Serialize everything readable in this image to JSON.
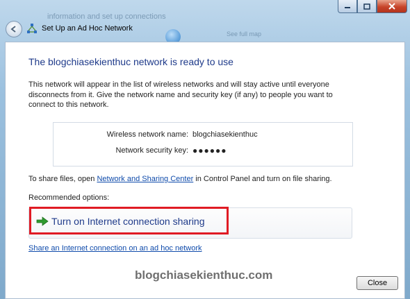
{
  "window": {
    "title": "Set Up an Ad Hoc Network",
    "caption_buttons": [
      "minimize",
      "maximize",
      "close"
    ]
  },
  "background": {
    "text_1": "information and set up connections",
    "text_2": "See full map"
  },
  "main": {
    "heading": "The blogchiasekienthuc network is ready to use",
    "description": "This network will appear in the list of wireless networks and will stay active until everyone disconnects from it. Give the network name and security key (if any) to people you want to connect to this network.",
    "network_name_label": "Wireless network name:",
    "network_name_value": "blogchiasekienthuc",
    "security_key_label": "Network security key:",
    "security_key_value": "●●●●●●",
    "share_text_before": "To share files, open ",
    "share_link": "Network and Sharing Center",
    "share_text_after": " in Control Panel and turn on file sharing.",
    "recommended_label": "Recommended options:",
    "option_label": "Turn on Internet connection sharing",
    "share_adhoc_link": "Share an Internet connection on an ad hoc network",
    "watermark": "blogchiasekienthuc.com",
    "close_label": "Close"
  },
  "colors": {
    "heading": "#1e3a8a",
    "link": "#0f4bab",
    "highlight": "#e01b24",
    "arrow": "#2e9a2e"
  }
}
